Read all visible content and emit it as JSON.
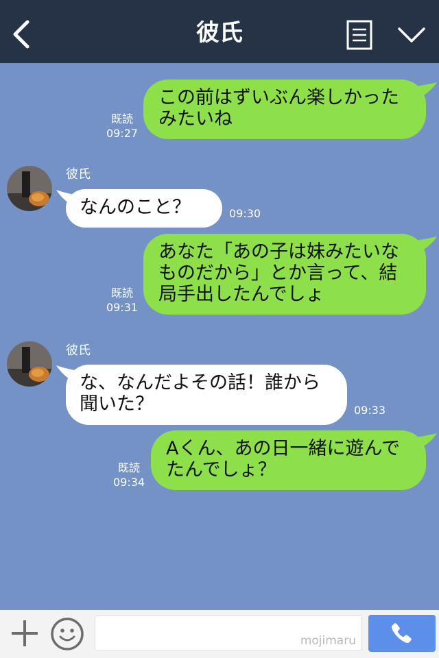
{
  "header": {
    "title": "彼氏"
  },
  "messages": [
    {
      "dir": "out",
      "text": "この前はずいぶん楽しかったみたいね",
      "read": "既読",
      "time": "09:27"
    },
    {
      "dir": "in",
      "sender": "彼氏",
      "text": "なんのこと？",
      "time": "09:30"
    },
    {
      "dir": "out",
      "text": "あなた「あの子は妹みたいなものだから」とか言って、結局手出したんでしょ",
      "read": "既読",
      "time": "09:31"
    },
    {
      "dir": "in",
      "sender": "彼氏",
      "text": "な、なんだよその話！誰から聞いた？",
      "time": "09:33"
    },
    {
      "dir": "out",
      "text": "Aくん、あの日一緒に遊んでたんでしょ？",
      "read": "既読",
      "time": "09:34"
    }
  ],
  "input": {
    "value": "",
    "watermark": "mojimaru"
  },
  "colors": {
    "header": "#263246",
    "chat_bg": "#7492c5",
    "outgoing_bubble": "#8de04a",
    "incoming_bubble": "#ffffff",
    "send_button": "#5b8fea"
  },
  "icons": {
    "back": "chevron-left-icon",
    "menu": "menu-list-icon",
    "collapse": "chevron-down-icon",
    "plus": "plus-icon",
    "emoji": "smiley-icon",
    "call": "phone-icon"
  }
}
